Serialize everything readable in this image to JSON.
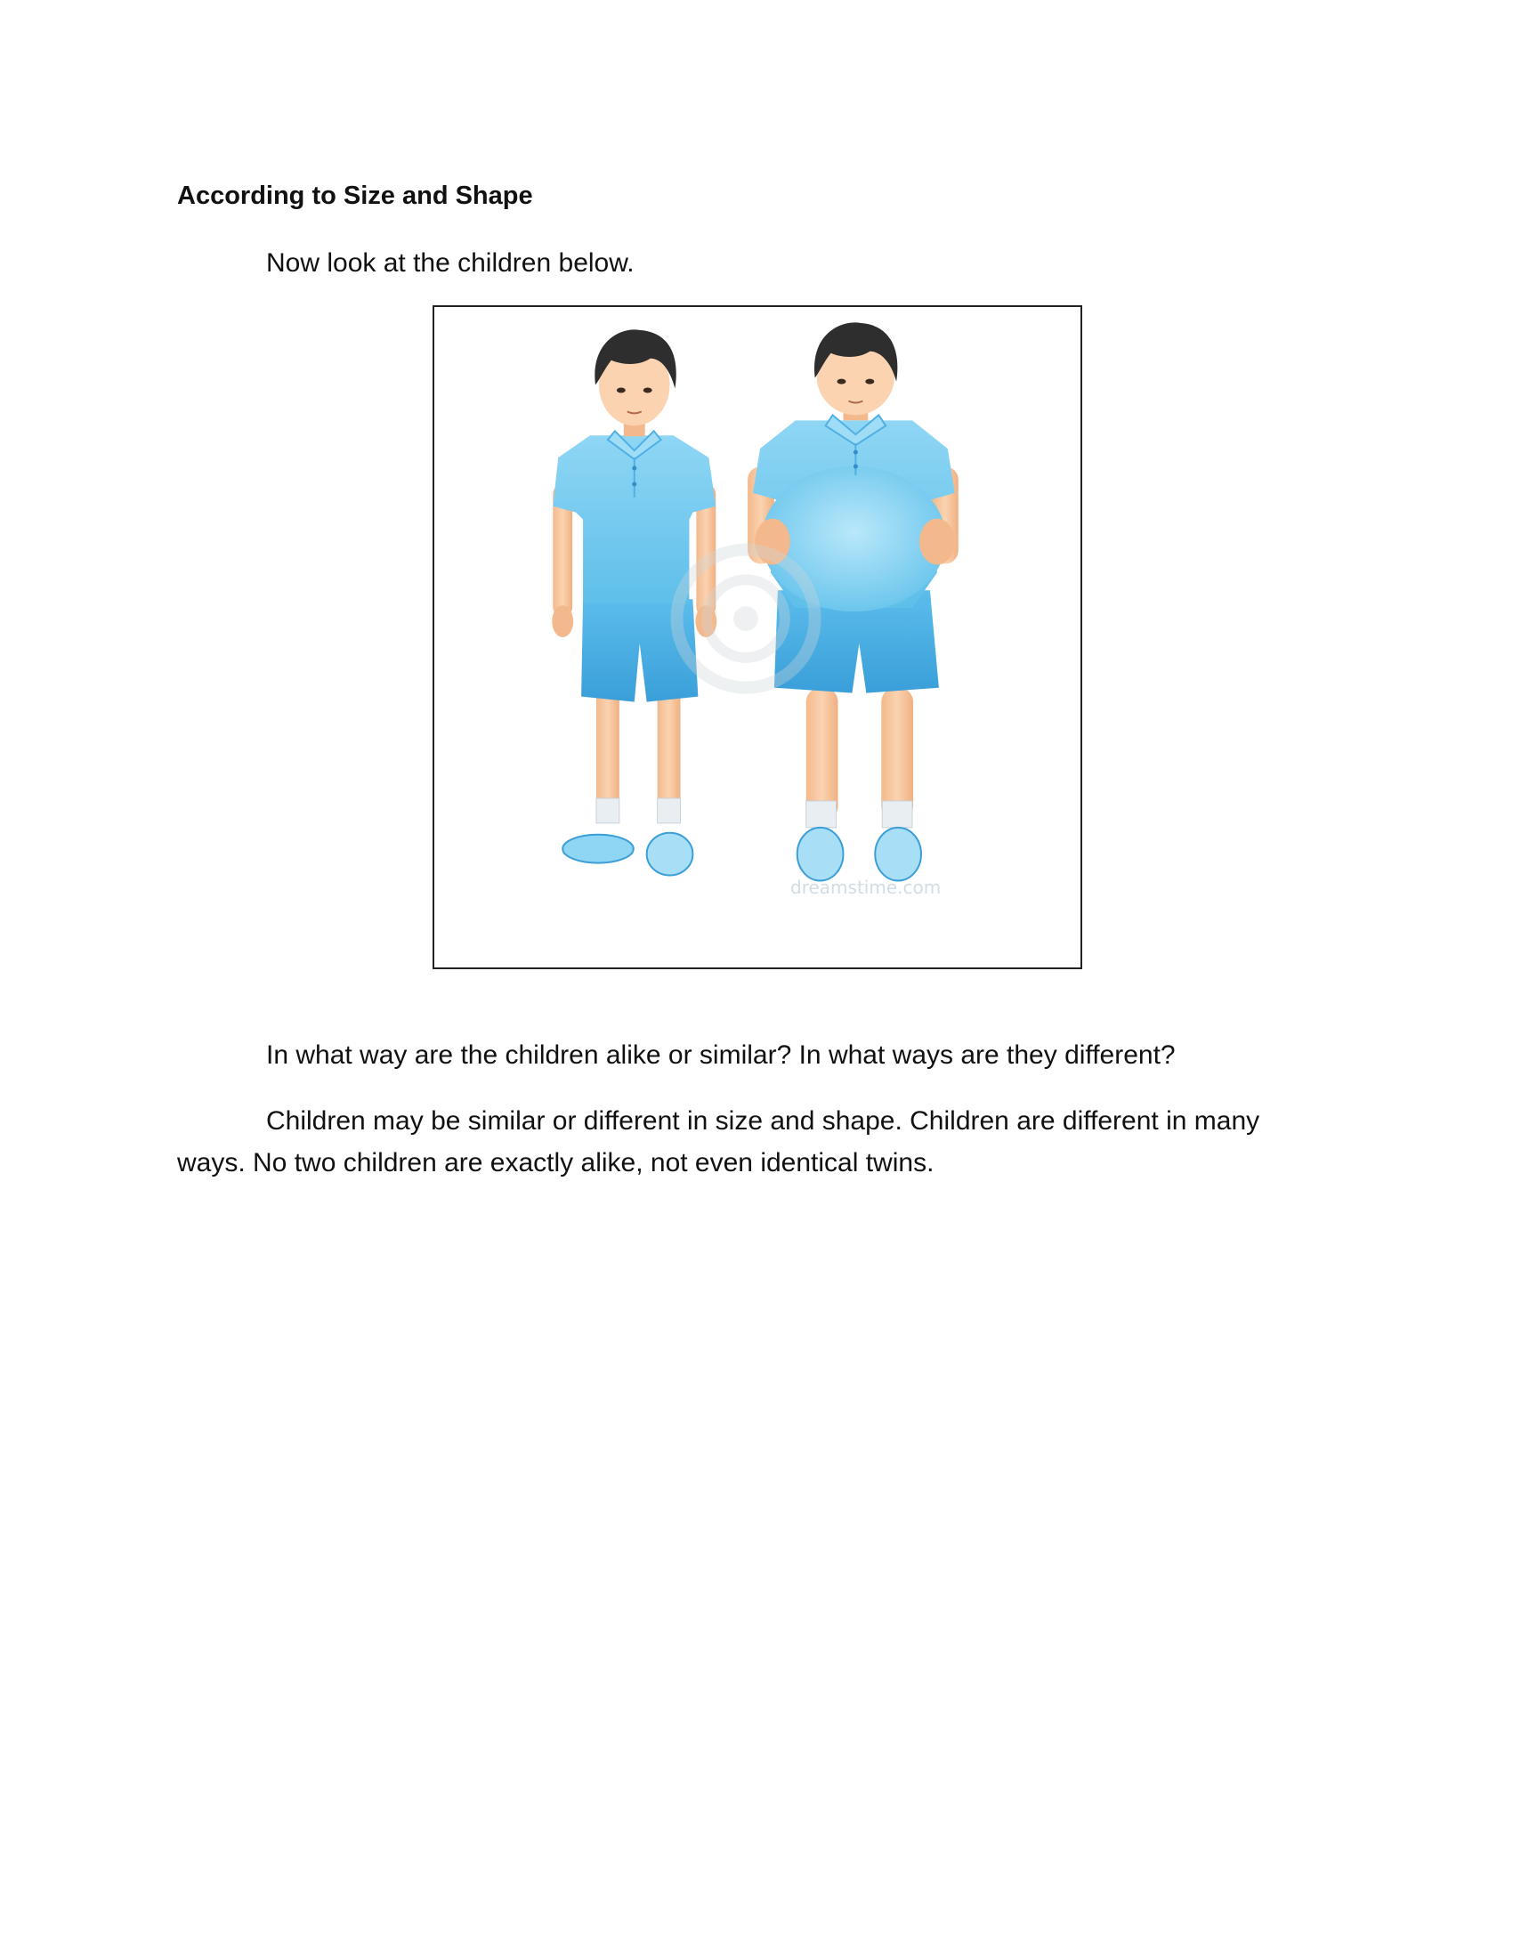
{
  "section": {
    "heading": "According to Size and Shape"
  },
  "paragraphs": {
    "intro": "Now look at the children below.",
    "question": "In what way are the children alike or similar? In what ways are they different?",
    "explanation": "Children may be similar or different in size and shape. Children are different in many ways. No two children are exactly alike, not even identical twins."
  },
  "figure": {
    "watermark": "dreamstime.com",
    "colors": {
      "shirt": "#7ecdf0",
      "shorts": "#4fb0e6",
      "skin": "#f8c9a0",
      "hair": "#2e2e2e",
      "frame": "#222222"
    }
  }
}
